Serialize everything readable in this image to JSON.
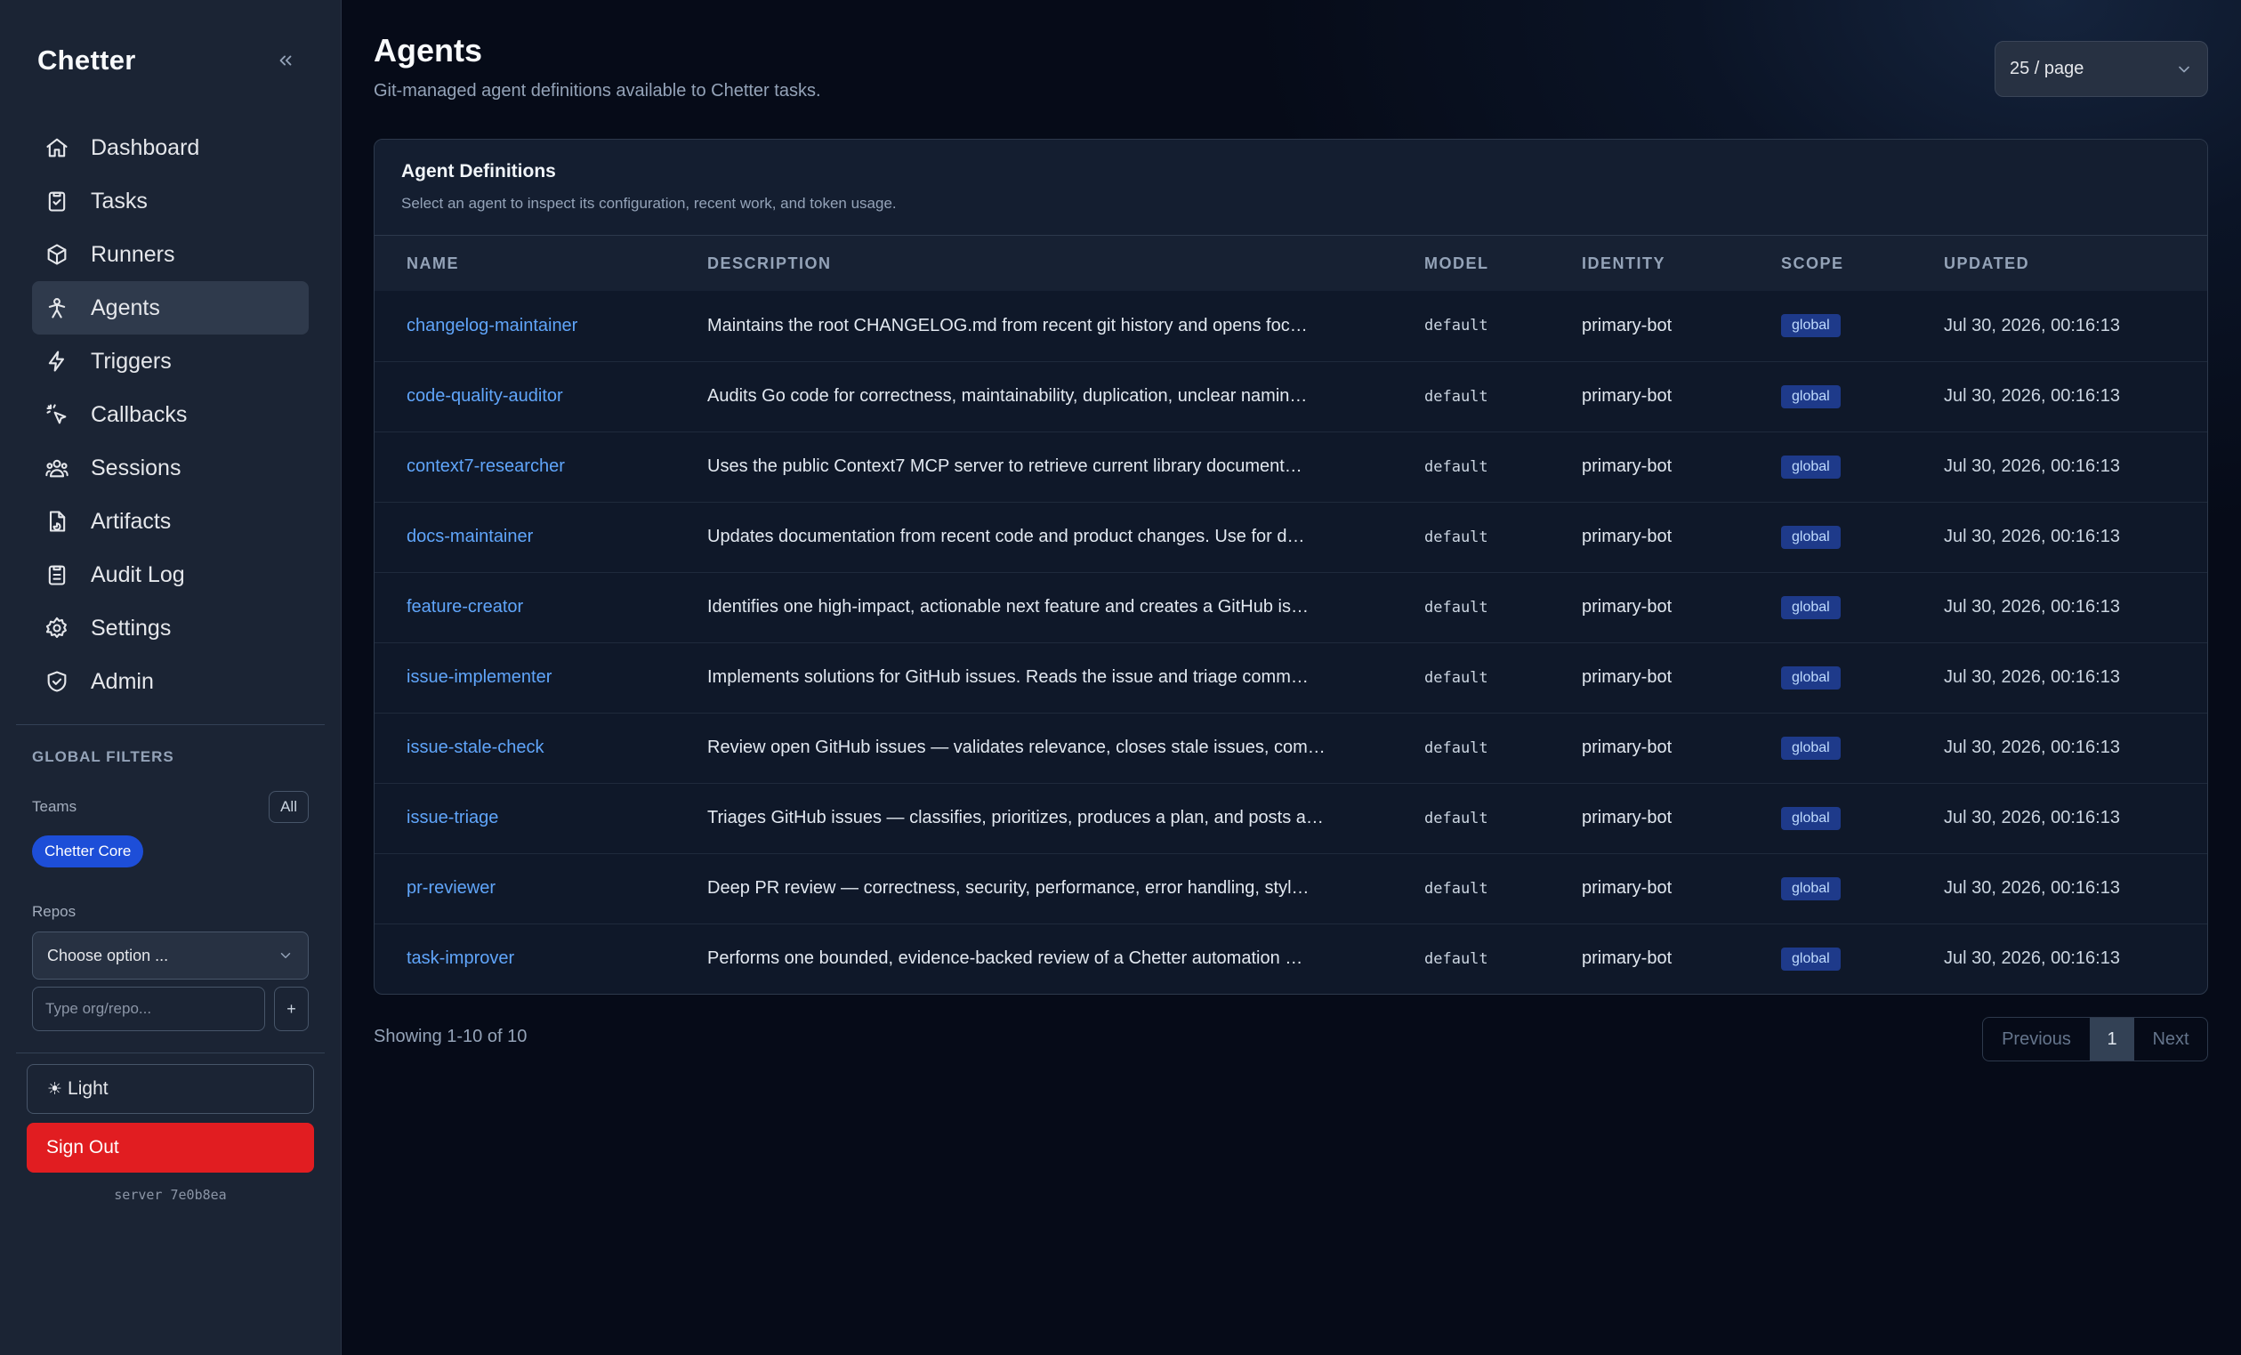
{
  "sidebar": {
    "brand": "Chetter",
    "nav": [
      {
        "label": "Dashboard",
        "icon": "home-icon"
      },
      {
        "label": "Tasks",
        "icon": "clipboard-check-icon"
      },
      {
        "label": "Runners",
        "icon": "cube-icon"
      },
      {
        "label": "Agents",
        "icon": "agent-icon",
        "active": true
      },
      {
        "label": "Triggers",
        "icon": "bolt-icon"
      },
      {
        "label": "Callbacks",
        "icon": "pointer-click-icon"
      },
      {
        "label": "Sessions",
        "icon": "users-icon"
      },
      {
        "label": "Artifacts",
        "icon": "file-chart-icon"
      },
      {
        "label": "Audit Log",
        "icon": "clipboard-list-icon"
      },
      {
        "label": "Settings",
        "icon": "gear-icon"
      },
      {
        "label": "Admin",
        "icon": "shield-check-icon"
      }
    ],
    "filters": {
      "title": "GLOBAL FILTERS",
      "teams_label": "Teams",
      "all_label": "All",
      "team_chip": "Chetter Core",
      "repos_label": "Repos",
      "repos_select": "Choose option ...",
      "repo_placeholder": "Type org/repo...",
      "add_label": "+"
    },
    "theme_label": "Light",
    "signout_label": "Sign Out",
    "server": "server 7e0b8ea"
  },
  "main": {
    "title": "Agents",
    "subtitle": "Git-managed agent definitions available to Chetter tasks.",
    "per_page": "25 / page",
    "card_title": "Agent Definitions",
    "card_subtitle": "Select an agent to inspect its configuration, recent work, and token usage.",
    "columns": [
      "NAME",
      "DESCRIPTION",
      "MODEL",
      "IDENTITY",
      "SCOPE",
      "UPDATED"
    ],
    "rows": [
      {
        "name": "changelog-maintainer",
        "description": "Maintains the root CHANGELOG.md from recent git history and opens foc…",
        "model": "default",
        "identity": "primary-bot",
        "scope": "global",
        "updated": "Jul 30, 2026, 00:16:13"
      },
      {
        "name": "code-quality-auditor",
        "description": "Audits Go code for correctness, maintainability, duplication, unclear namin…",
        "model": "default",
        "identity": "primary-bot",
        "scope": "global",
        "updated": "Jul 30, 2026, 00:16:13"
      },
      {
        "name": "context7-researcher",
        "description": "Uses the public Context7 MCP server to retrieve current library document…",
        "model": "default",
        "identity": "primary-bot",
        "scope": "global",
        "updated": "Jul 30, 2026, 00:16:13"
      },
      {
        "name": "docs-maintainer",
        "description": "Updates documentation from recent code and product changes. Use for d…",
        "model": "default",
        "identity": "primary-bot",
        "scope": "global",
        "updated": "Jul 30, 2026, 00:16:13"
      },
      {
        "name": "feature-creator",
        "description": "Identifies one high-impact, actionable next feature and creates a GitHub is…",
        "model": "default",
        "identity": "primary-bot",
        "scope": "global",
        "updated": "Jul 30, 2026, 00:16:13"
      },
      {
        "name": "issue-implementer",
        "description": "Implements solutions for GitHub issues. Reads the issue and triage comm…",
        "model": "default",
        "identity": "primary-bot",
        "scope": "global",
        "updated": "Jul 30, 2026, 00:16:13"
      },
      {
        "name": "issue-stale-check",
        "description": "Review open GitHub issues — validates relevance, closes stale issues, com…",
        "model": "default",
        "identity": "primary-bot",
        "scope": "global",
        "updated": "Jul 30, 2026, 00:16:13"
      },
      {
        "name": "issue-triage",
        "description": "Triages GitHub issues — classifies, prioritizes, produces a plan, and posts a…",
        "model": "default",
        "identity": "primary-bot",
        "scope": "global",
        "updated": "Jul 30, 2026, 00:16:13"
      },
      {
        "name": "pr-reviewer",
        "description": "Deep PR review — correctness, security, performance, error handling, styl…",
        "model": "default",
        "identity": "primary-bot",
        "scope": "global",
        "updated": "Jul 30, 2026, 00:16:13"
      },
      {
        "name": "task-improver",
        "description": "Performs one bounded, evidence-backed review of a Chetter automation …",
        "model": "default",
        "identity": "primary-bot",
        "scope": "global",
        "updated": "Jul 30, 2026, 00:16:13"
      }
    ],
    "showing": "Showing 1-10 of 10",
    "pager": {
      "previous": "Previous",
      "current": "1",
      "next": "Next"
    }
  },
  "colors": {
    "accent": "#60a5fa",
    "active_nav": "#2f3a4c",
    "danger": "#e11d21",
    "chip": "#1d4ed8",
    "badge": "#1e3a8a"
  }
}
